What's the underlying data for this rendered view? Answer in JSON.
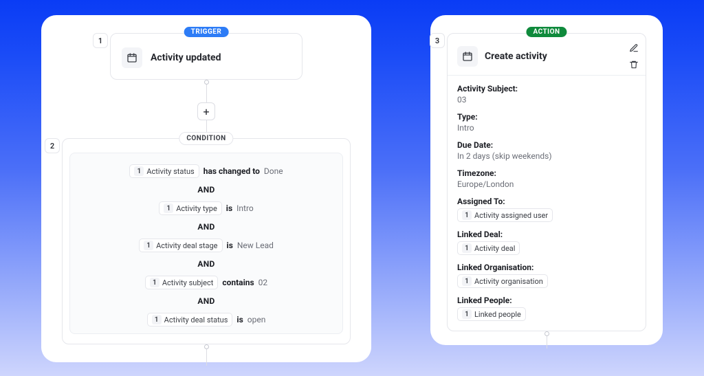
{
  "trigger": {
    "step_num": "1",
    "badge": "TRIGGER",
    "title": "Activity updated"
  },
  "condition": {
    "step_num": "2",
    "badge": "CONDITION",
    "and_label": "AND",
    "rows": [
      {
        "chip_num": "1",
        "chip_label": "Activity status",
        "op": "has changed to",
        "val": "Done"
      },
      {
        "chip_num": "1",
        "chip_label": "Activity type",
        "op": "is",
        "val": "Intro"
      },
      {
        "chip_num": "1",
        "chip_label": "Activity deal stage",
        "op": "is",
        "val": "New Lead"
      },
      {
        "chip_num": "1",
        "chip_label": "Activity subject",
        "op": "contains",
        "val": "02"
      },
      {
        "chip_num": "1",
        "chip_label": "Activity deal status",
        "op": "is",
        "val": "open"
      }
    ]
  },
  "action": {
    "step_num": "3",
    "badge": "ACTION",
    "title": "Create activity",
    "fields": [
      {
        "label": "Activity Subject:",
        "value": "03"
      },
      {
        "label": "Type:",
        "value": "Intro"
      },
      {
        "label": "Due Date:",
        "value": "In 2 days (skip weekends)"
      },
      {
        "label": "Timezone:",
        "value": "Europe/London"
      },
      {
        "label": "Assigned To:",
        "chip_num": "1",
        "chip_label": "Activity assigned user"
      },
      {
        "label": "Linked Deal:",
        "chip_num": "1",
        "chip_label": "Activity deal"
      },
      {
        "label": "Linked Organisation:",
        "chip_num": "1",
        "chip_label": "Activity organisation"
      },
      {
        "label": "Linked People:",
        "chip_num": "1",
        "chip_label": "Linked people"
      }
    ]
  }
}
